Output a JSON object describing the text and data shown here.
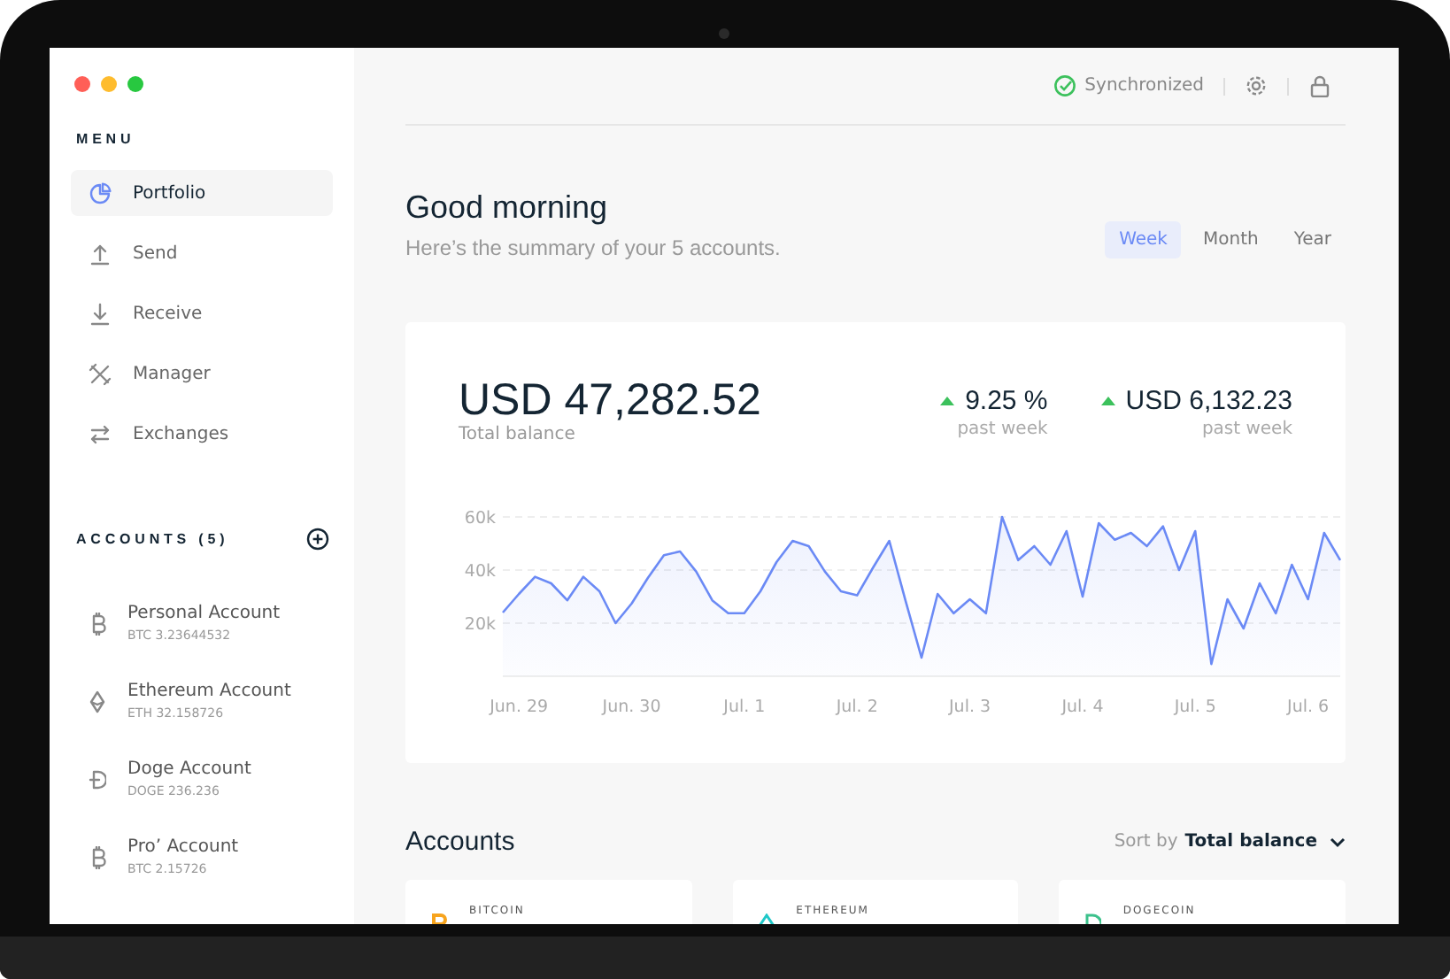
{
  "menu": {
    "title": "MENU",
    "items": [
      {
        "label": "Portfolio",
        "selected": true
      },
      {
        "label": "Send",
        "selected": false
      },
      {
        "label": "Receive",
        "selected": false
      },
      {
        "label": "Manager",
        "selected": false
      },
      {
        "label": "Exchanges",
        "selected": false
      }
    ]
  },
  "accounts_sidebar": {
    "title": "ACCOUNTS (5)",
    "items": [
      {
        "name": "Personal Account",
        "balance": "BTC 3.23644532"
      },
      {
        "name": "Ethereum Account",
        "balance": "ETH 32.158726"
      },
      {
        "name": "Doge Account",
        "balance": "DOGE 236.236"
      },
      {
        "name": "Pro’ Account",
        "balance": "BTC 2.15726"
      }
    ]
  },
  "top_bar": {
    "status": "Synchronized"
  },
  "greeting": {
    "title": "Good morning",
    "subtitle": "Here’s the summary of your 5 accounts."
  },
  "period_tabs": [
    {
      "label": "Week",
      "selected": true
    },
    {
      "label": "Month",
      "selected": false
    },
    {
      "label": "Year",
      "selected": false
    }
  ],
  "summary": {
    "balance": "USD 47,282.52",
    "balance_label": "Total balance",
    "stats": [
      {
        "value": "9.25 %",
        "label": "past week",
        "positive": true
      },
      {
        "value": "USD 6,132.23",
        "label": "past week",
        "positive": true
      }
    ],
    "chart_data": {
      "type": "area",
      "grid": true,
      "ylim": [
        0,
        60000
      ],
      "categories": [
        null,
        "Jun. 29",
        null,
        null,
        null,
        null,
        null,
        null,
        "Jun. 30",
        null,
        null,
        null,
        null,
        null,
        null,
        "Jul. 1",
        null,
        null,
        null,
        null,
        null,
        null,
        "Jul. 2",
        null,
        null,
        null,
        null,
        null,
        null,
        "Jul. 3",
        null,
        null,
        null,
        null,
        null,
        null,
        "Jul. 4",
        null,
        null,
        null,
        null,
        null,
        null,
        "Jul. 5",
        null,
        null,
        null,
        null,
        null,
        null,
        "Jul. 6",
        null,
        null
      ],
      "yticks": [
        {
          "value": 20000,
          "label": "20k"
        },
        {
          "value": 40000,
          "label": "40k"
        },
        {
          "value": 60000,
          "label": "60k"
        }
      ],
      "series": [
        {
          "color": "#6b8af5",
          "values": [
            24000,
            31000,
            37500,
            35000,
            28600,
            37500,
            32000,
            20000,
            27400,
            37000,
            45600,
            47000,
            39500,
            28600,
            23700,
            23700,
            32000,
            43000,
            51000,
            49000,
            39500,
            32000,
            30500,
            41000,
            51000,
            28600,
            7000,
            31000,
            23700,
            29000,
            23700,
            60000,
            43700,
            49000,
            42000,
            54700,
            30000,
            57700,
            51400,
            54000,
            49000,
            56500,
            40000,
            54700,
            4600,
            29000,
            18000,
            35000,
            23700,
            42000,
            29000,
            54000,
            43700
          ]
        }
      ]
    }
  },
  "accounts_section": {
    "title": "Accounts",
    "sort_label": "Sort by",
    "sort_value": "Total balance",
    "cards": [
      {
        "currency": "BITCOIN"
      },
      {
        "currency": "ETHEREUM"
      },
      {
        "currency": "DOGECOIN"
      }
    ]
  }
}
